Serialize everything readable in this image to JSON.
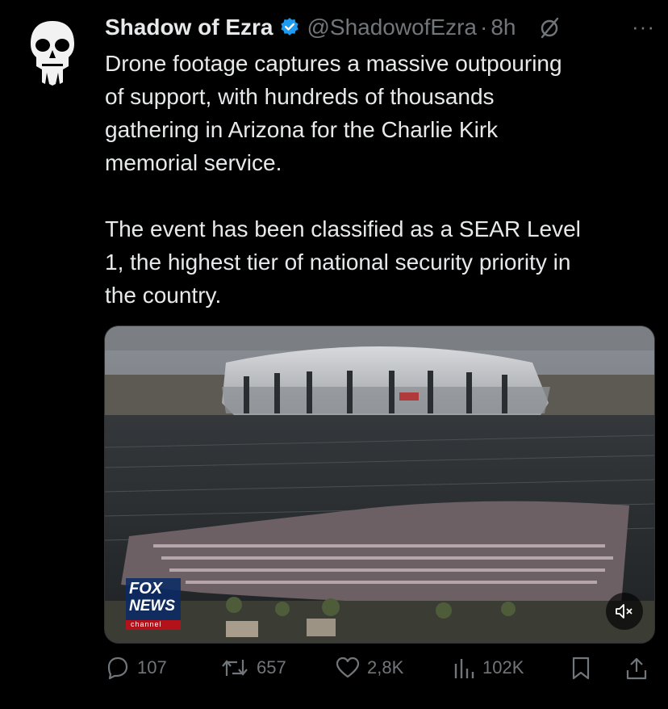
{
  "tweet": {
    "author_name": "Shadow of Ezra",
    "handle": "@ShadowofEzra",
    "separator": "·",
    "time": "8h",
    "more": "···",
    "paragraphs": [
      "Drone footage captures a massive outpouring\nof support, with hundreds of thousands\ngathering in Arizona for the Charlie Kirk\nmemorial service.",
      "The event has been classified as a SEAR Level\n1, the highest tier of national security priority in\nthe country."
    ],
    "media": {
      "logo_line1": "FOX",
      "logo_line2": "NEWS",
      "logo_line3": "channel"
    },
    "actions": {
      "replies": "107",
      "reposts": "657",
      "likes": "2,8K",
      "views": "102K"
    }
  },
  "icons": [
    "punisher-skull-avatar",
    "verified-badge-icon",
    "grok-icon",
    "reply-icon",
    "repost-icon",
    "like-icon",
    "views-icon",
    "bookmark-icon",
    "share-icon",
    "mute-icon"
  ],
  "colors": {
    "background": "#000000",
    "text": "#e7e9ea",
    "muted": "#71767b",
    "verified": "#1d9bf0"
  }
}
